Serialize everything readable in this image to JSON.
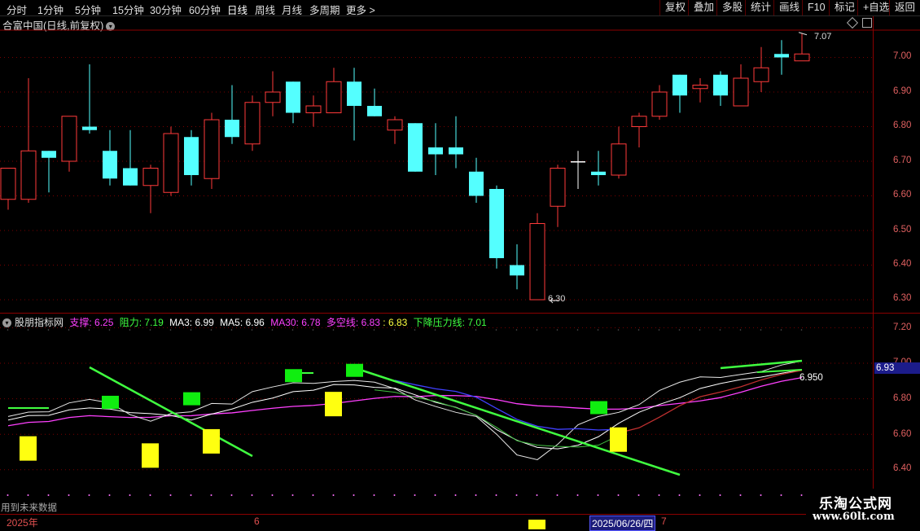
{
  "toolbar": {
    "periods": [
      "分时",
      "1分钟",
      "5分钟",
      "15分钟",
      "30分钟",
      "60分钟",
      "日线",
      "周线",
      "月线",
      "多周期",
      "更多"
    ],
    "active_period": "日线",
    "more_arrow": ">",
    "tools": [
      "复权",
      "叠加",
      "多股",
      "统计",
      "画线",
      "F10",
      "标记",
      "+自选",
      "返回"
    ]
  },
  "main_chart": {
    "stock_title": "合富中国(日线,前复权)",
    "price_axis": [
      "7.00",
      "6.90",
      "6.80",
      "6.70",
      "6.60",
      "6.50",
      "6.40",
      "6.30"
    ],
    "high_label": "7.07",
    "low_label": "6.30",
    "up_color": "#ff3a3a",
    "down_color": "#54ffff",
    "candles": [
      {
        "o": 6.59,
        "h": 6.62,
        "l": 6.56,
        "c": 6.68
      },
      {
        "o": 6.59,
        "h": 6.94,
        "l": 6.58,
        "c": 6.73
      },
      {
        "o": 6.73,
        "h": 6.73,
        "l": 6.61,
        "c": 6.71
      },
      {
        "o": 6.7,
        "h": 6.83,
        "l": 6.67,
        "c": 6.83
      },
      {
        "o": 6.8,
        "h": 6.98,
        "l": 6.78,
        "c": 6.79
      },
      {
        "o": 6.73,
        "h": 6.79,
        "l": 6.63,
        "c": 6.65
      },
      {
        "o": 6.68,
        "h": 6.79,
        "l": 6.63,
        "c": 6.63
      },
      {
        "o": 6.63,
        "h": 6.69,
        "l": 6.55,
        "c": 6.68
      },
      {
        "o": 6.61,
        "h": 6.8,
        "l": 6.6,
        "c": 6.78
      },
      {
        "o": 6.77,
        "h": 6.79,
        "l": 6.63,
        "c": 6.66
      },
      {
        "o": 6.65,
        "h": 6.84,
        "l": 6.62,
        "c": 6.82
      },
      {
        "o": 6.82,
        "h": 6.92,
        "l": 6.75,
        "c": 6.77
      },
      {
        "o": 6.75,
        "h": 6.89,
        "l": 6.73,
        "c": 6.87
      },
      {
        "o": 6.87,
        "h": 6.96,
        "l": 6.83,
        "c": 6.9
      },
      {
        "o": 6.93,
        "h": 6.93,
        "l": 6.81,
        "c": 6.84
      },
      {
        "o": 6.84,
        "h": 6.89,
        "l": 6.8,
        "c": 6.86
      },
      {
        "o": 6.84,
        "h": 6.97,
        "l": 6.84,
        "c": 6.93
      },
      {
        "o": 6.93,
        "h": 6.97,
        "l": 6.76,
        "c": 6.86
      },
      {
        "o": 6.86,
        "h": 6.91,
        "l": 6.83,
        "c": 6.83
      },
      {
        "o": 6.79,
        "h": 6.83,
        "l": 6.75,
        "c": 6.82
      },
      {
        "o": 6.81,
        "h": 6.81,
        "l": 6.67,
        "c": 6.67
      },
      {
        "o": 6.74,
        "h": 6.81,
        "l": 6.66,
        "c": 6.72
      },
      {
        "o": 6.74,
        "h": 6.83,
        "l": 6.68,
        "c": 6.72
      },
      {
        "o": 6.67,
        "h": 6.71,
        "l": 6.58,
        "c": 6.6
      },
      {
        "o": 6.62,
        "h": 6.63,
        "l": 6.39,
        "c": 6.42
      },
      {
        "o": 6.4,
        "h": 6.46,
        "l": 6.33,
        "c": 6.37
      },
      {
        "o": 6.3,
        "h": 6.55,
        "l": 6.3,
        "c": 6.52
      },
      {
        "o": 6.57,
        "h": 6.69,
        "l": 6.51,
        "c": 6.68
      },
      {
        "o": 6.7,
        "h": 6.73,
        "l": 6.62,
        "c": 6.7
      },
      {
        "o": 6.67,
        "h": 6.73,
        "l": 6.63,
        "c": 6.66
      },
      {
        "o": 6.66,
        "h": 6.8,
        "l": 6.65,
        "c": 6.75
      },
      {
        "o": 6.8,
        "h": 6.84,
        "l": 6.74,
        "c": 6.83
      },
      {
        "o": 6.83,
        "h": 6.92,
        "l": 6.82,
        "c": 6.9
      },
      {
        "o": 6.95,
        "h": 6.95,
        "l": 6.84,
        "c": 6.89
      },
      {
        "o": 6.91,
        "h": 6.94,
        "l": 6.87,
        "c": 6.92
      },
      {
        "o": 6.95,
        "h": 6.96,
        "l": 6.86,
        "c": 6.89
      },
      {
        "o": 6.86,
        "h": 6.98,
        "l": 6.86,
        "c": 6.94
      },
      {
        "o": 6.93,
        "h": 7.03,
        "l": 6.9,
        "c": 6.97
      },
      {
        "o": 7.01,
        "h": 7.05,
        "l": 6.95,
        "c": 7.0
      },
      {
        "o": 6.99,
        "h": 7.07,
        "l": 6.99,
        "c": 7.01
      }
    ]
  },
  "indicator": {
    "name": "股朋指标网",
    "items": [
      {
        "label": "支撑: 6.25",
        "color": "#ff40ff"
      },
      {
        "label": "阻力: 7.19",
        "color": "#40ff40"
      },
      {
        "label": "MA3: 6.99",
        "color": "#ffffff"
      },
      {
        "label": "MA5: 6.96",
        "color": "#ffffff"
      },
      {
        "label": "MA30: 6.78",
        "color": "#ff40ff"
      },
      {
        "label": "多空线: 6.83",
        "color": "#ff40ff"
      },
      {
        "label": ": 6.83",
        "color": "#ffff40"
      },
      {
        "label": "下降压力线: 7.01",
        "color": "#40ff40"
      }
    ],
    "axis": [
      "7.20",
      "7.00",
      "6.80",
      "6.60",
      "6.40"
    ],
    "current_value": "6.93",
    "line_value": "6.950",
    "footer_note": "用到未来数据",
    "green_blocks": [
      {
        "i": 5,
        "v": 6.78
      },
      {
        "i": 9,
        "v": 6.8
      },
      {
        "i": 14,
        "v": 6.93
      },
      {
        "i": 17,
        "v": 6.96
      },
      {
        "i": 29,
        "v": 6.75
      }
    ],
    "yellow_blocks": [
      {
        "i": 1,
        "v": 6.52
      },
      {
        "i": 7,
        "v": 6.48
      },
      {
        "i": 10,
        "v": 6.56
      },
      {
        "i": 16,
        "v": 6.77
      },
      {
        "i": 30,
        "v": 6.57
      },
      {
        "i": 26,
        "v": 6.05
      }
    ]
  },
  "timeline": {
    "year_label": "2025年",
    "month6": "6",
    "selected_date": "2025/06/26/四",
    "month7": "7"
  },
  "watermark": {
    "line1": "乐淘公式网",
    "line2": "www.60lt.com"
  }
}
